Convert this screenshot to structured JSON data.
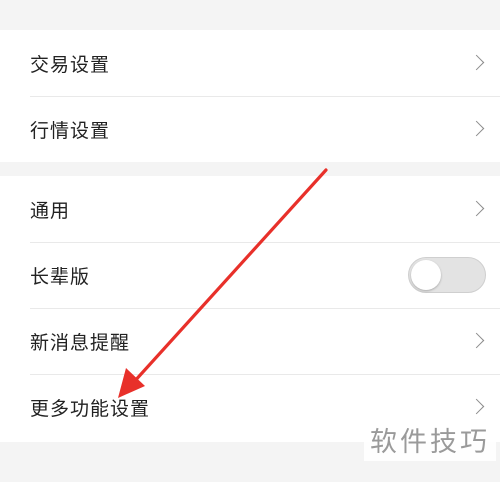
{
  "settings": {
    "group1": [
      {
        "label": "交易设置"
      },
      {
        "label": "行情设置"
      }
    ],
    "group2": [
      {
        "label": "通用"
      },
      {
        "label": "长辈版",
        "toggle": false
      },
      {
        "label": "新消息提醒"
      },
      {
        "label": "更多功能设置"
      }
    ]
  },
  "annotation": {
    "arrow_color": "#e8302a"
  },
  "watermark": "软件技巧",
  "icons": [
    "chevron-right-icon",
    "toggle-switch"
  ]
}
